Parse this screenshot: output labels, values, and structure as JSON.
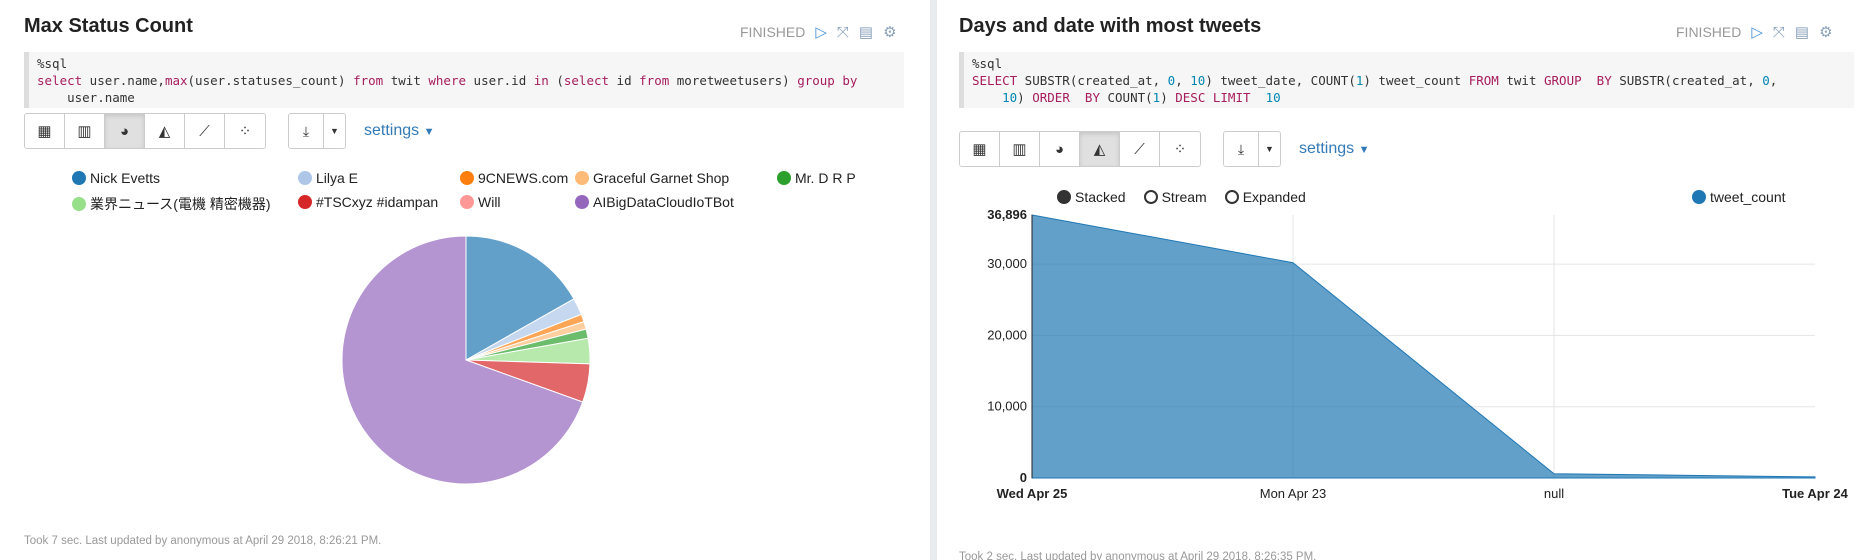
{
  "left_paragraph": {
    "title": "Max Status Count",
    "status": "FINISHED",
    "code_line1": "%sql",
    "code_line2_parts": [
      "select",
      " user.name,",
      "max",
      "(user.statuses_count) ",
      "from",
      " twit ",
      "where",
      " user.id ",
      "in",
      " (",
      "select",
      " id ",
      "from",
      " moretweetusers) ",
      "group by"
    ],
    "code_line3": "    user.name",
    "settings_label": "settings",
    "footer": "Took 7 sec. Last updated by anonymous at April 29 2018, 8:26:21 PM.",
    "icons": [
      "table-icon",
      "bar-chart-icon",
      "pie-chart-icon",
      "area-chart-icon",
      "line-chart-icon",
      "scatter-chart-icon"
    ],
    "active_chart": "pie-chart-icon"
  },
  "right_paragraph": {
    "title": "Days and date with most tweets",
    "status": "FINISHED",
    "code_line1": "%sql",
    "code_line2_parts": [
      "SELECT",
      " SUBSTR(created_at, ",
      "0",
      ", ",
      "10",
      ") tweet_date, COUNT(",
      "1",
      ") tweet_count ",
      "FROM",
      " twit ",
      "GROUP  BY",
      " SUBSTR(created_at, ",
      "0",
      ","
    ],
    "code_line3_parts": [
      "    ",
      "10",
      ") ",
      "ORDER  BY",
      " COUNT(",
      "1",
      ") ",
      "DESC LIMIT",
      "  ",
      "10"
    ],
    "settings_label": "settings",
    "footer": "Took 2 sec. Last updated by anonymous at April 29 2018, 8:26:35 PM.",
    "icons": [
      "table-icon",
      "bar-chart-icon",
      "pie-chart-icon",
      "area-chart-icon",
      "line-chart-icon",
      "scatter-chart-icon"
    ],
    "active_chart": "area-chart-icon",
    "radio_options": [
      "Stacked",
      "Stream",
      "Expanded"
    ],
    "selected_radio": "Stacked"
  },
  "chart_data": [
    {
      "type": "pie",
      "title": "",
      "categories": [
        "Nick Evetts",
        "Lilya E",
        "9CNEWS.com",
        "Graceful Garnet Shop",
        "Mr. D R P",
        "業界ニュース(電機 精密機器)",
        "#TSCxyz #idampan",
        "Will",
        "AIBigDataCloudIoTBot"
      ],
      "values": [
        16.8,
        2.2,
        1.0,
        1.0,
        1.2,
        3.3,
        5.0,
        0,
        69.5
      ],
      "colors": [
        "#1f77b4",
        "#aec7e8",
        "#ff7f0e",
        "#ffbb78",
        "#2ca02c",
        "#98df8a",
        "#d62728",
        "#ff9896",
        "#9467bd"
      ],
      "legend": "top"
    },
    {
      "type": "area",
      "title": "",
      "categories": [
        "Wed Apr 25",
        "Mon Apr 23",
        "null",
        "Tue Apr 24"
      ],
      "series": [
        {
          "name": "tweet_count",
          "values": [
            36896,
            30200,
            600,
            150
          ],
          "color": "#1f77b4"
        }
      ],
      "yticks": [
        0,
        10000,
        20000,
        30000,
        36896
      ],
      "ytick_labels": [
        "0",
        "10,000",
        "20,000",
        "30,000",
        "36,896"
      ],
      "ylim": [
        0,
        36896
      ],
      "grid": true,
      "legend": "top-right"
    }
  ]
}
